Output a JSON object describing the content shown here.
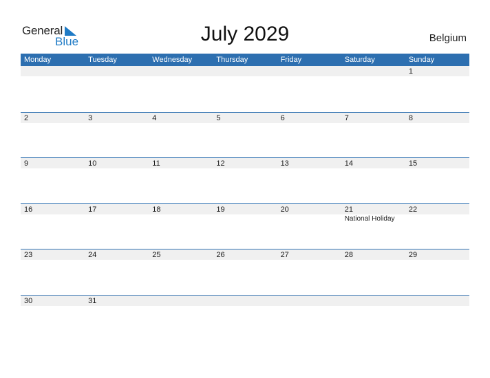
{
  "logo": {
    "line1": "General",
    "line2": "Blue"
  },
  "title": "July 2029",
  "country": "Belgium",
  "colors": {
    "accent": "#2d6fb0",
    "logo_blue": "#1f7bc6",
    "cell_bar": "#f0f0f0"
  },
  "weekdays": [
    "Monday",
    "Tuesday",
    "Wednesday",
    "Thursday",
    "Friday",
    "Saturday",
    "Sunday"
  ],
  "weeks": [
    [
      {
        "d": ""
      },
      {
        "d": ""
      },
      {
        "d": ""
      },
      {
        "d": ""
      },
      {
        "d": ""
      },
      {
        "d": ""
      },
      {
        "d": "1"
      }
    ],
    [
      {
        "d": "2"
      },
      {
        "d": "3"
      },
      {
        "d": "4"
      },
      {
        "d": "5"
      },
      {
        "d": "6"
      },
      {
        "d": "7"
      },
      {
        "d": "8"
      }
    ],
    [
      {
        "d": "9"
      },
      {
        "d": "10"
      },
      {
        "d": "11"
      },
      {
        "d": "12"
      },
      {
        "d": "13"
      },
      {
        "d": "14"
      },
      {
        "d": "15"
      }
    ],
    [
      {
        "d": "16"
      },
      {
        "d": "17"
      },
      {
        "d": "18"
      },
      {
        "d": "19"
      },
      {
        "d": "20"
      },
      {
        "d": "21",
        "event": "National Holiday"
      },
      {
        "d": "22"
      }
    ],
    [
      {
        "d": "23"
      },
      {
        "d": "24"
      },
      {
        "d": "25"
      },
      {
        "d": "26"
      },
      {
        "d": "27"
      },
      {
        "d": "28"
      },
      {
        "d": "29"
      }
    ],
    [
      {
        "d": "30"
      },
      {
        "d": "31"
      },
      {
        "d": ""
      },
      {
        "d": ""
      },
      {
        "d": ""
      },
      {
        "d": ""
      },
      {
        "d": ""
      }
    ]
  ]
}
